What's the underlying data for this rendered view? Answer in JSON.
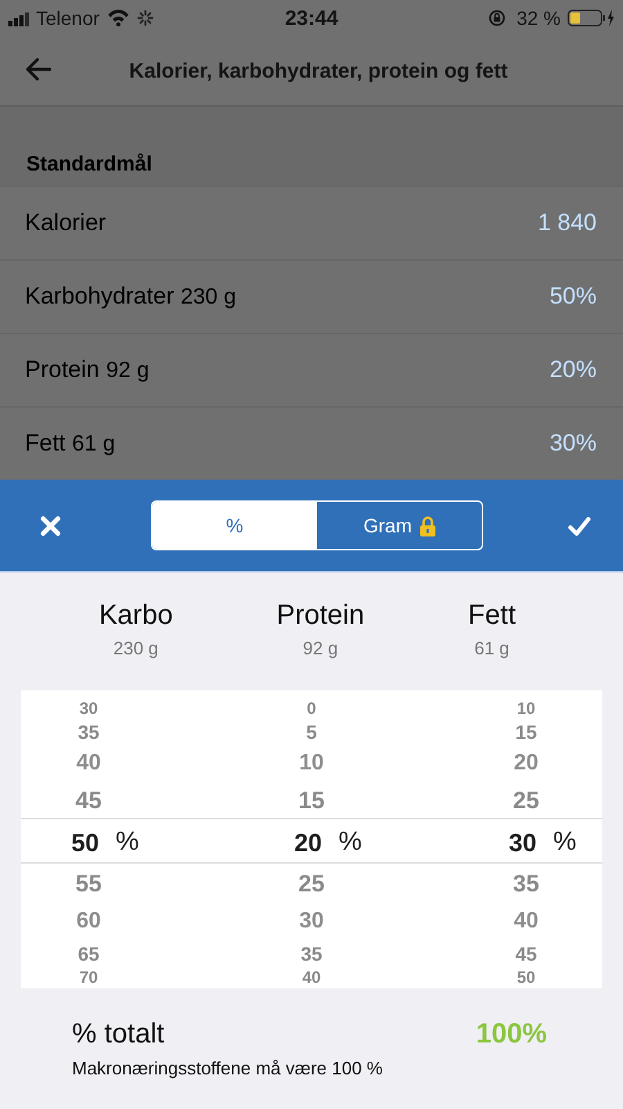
{
  "status_bar": {
    "carrier": "Telenor",
    "time": "23:44",
    "battery": "32 %"
  },
  "header": {
    "title": "Kalorier, karbohydrater, protein og fett"
  },
  "section": {
    "title": "Standardmål",
    "rows": [
      {
        "label": "Kalorier",
        "detail": "",
        "value": "1 840"
      },
      {
        "label": "Karbohydrater",
        "detail": "230 g",
        "value": "50%"
      },
      {
        "label": "Protein",
        "detail": "92 g",
        "value": "20%"
      },
      {
        "label": "Fett",
        "detail": "61 g",
        "value": "30%"
      }
    ]
  },
  "sheet": {
    "segments": [
      {
        "label": "%",
        "selected": true,
        "locked": false
      },
      {
        "label": "Gram",
        "selected": false,
        "locked": true
      }
    ],
    "columns": [
      {
        "name": "Karbo",
        "grams": "230 g",
        "unit": "%",
        "items": [
          {
            "text": "30",
            "selected": false
          },
          {
            "text": "35",
            "selected": false
          },
          {
            "text": "40",
            "selected": false
          },
          {
            "text": "45",
            "selected": false
          },
          {
            "text": "50",
            "selected": true
          },
          {
            "text": "55",
            "selected": false
          },
          {
            "text": "60",
            "selected": false
          },
          {
            "text": "65",
            "selected": false
          },
          {
            "text": "70",
            "selected": false
          }
        ]
      },
      {
        "name": "Protein",
        "grams": "92 g",
        "unit": "%",
        "items": [
          {
            "text": "0",
            "selected": false
          },
          {
            "text": "5",
            "selected": false
          },
          {
            "text": "10",
            "selected": false
          },
          {
            "text": "15",
            "selected": false
          },
          {
            "text": "20",
            "selected": true
          },
          {
            "text": "25",
            "selected": false
          },
          {
            "text": "30",
            "selected": false
          },
          {
            "text": "35",
            "selected": false
          },
          {
            "text": "40",
            "selected": false
          }
        ]
      },
      {
        "name": "Fett",
        "grams": "61 g",
        "unit": "%",
        "items": [
          {
            "text": "10",
            "selected": false
          },
          {
            "text": "15",
            "selected": false
          },
          {
            "text": "20",
            "selected": false
          },
          {
            "text": "25",
            "selected": false
          },
          {
            "text": "30",
            "selected": true
          },
          {
            "text": "35",
            "selected": false
          },
          {
            "text": "40",
            "selected": false
          },
          {
            "text": "45",
            "selected": false
          },
          {
            "text": "50",
            "selected": false
          }
        ]
      }
    ],
    "total": {
      "label": "% totalt",
      "value": "100%",
      "note": "Makronæringsstoffene må være 100 %"
    }
  }
}
